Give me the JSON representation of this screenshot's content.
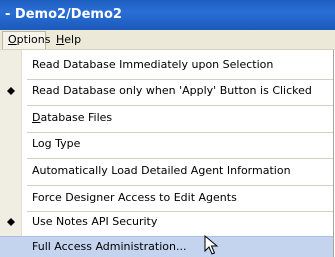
{
  "window": {
    "title": "- Demo2/Demo2"
  },
  "menubar": {
    "options_prefix": "",
    "options_accel": "O",
    "options_rest": "ptions",
    "help_accel": "H",
    "help_rest": "elp"
  },
  "menu_items": [
    {
      "label": "Read Database Immediately upon Selection",
      "checked": false
    },
    {
      "label": "Read Database only when 'Apply' Button is Clicked",
      "checked": true
    },
    {
      "label_accel": "D",
      "label_rest": "atabase Files",
      "checked": false
    },
    {
      "label": "Log Type",
      "checked": false
    },
    {
      "label": "Automatically Load Detailed Agent Information",
      "checked": false
    },
    {
      "label": "Force Designer Access to Edit Agents",
      "checked": false
    },
    {
      "label": "Use Notes API Security",
      "checked": true
    },
    {
      "label": "Full Access Administration...",
      "checked": false,
      "highlighted": true
    }
  ],
  "colors": {
    "title_bar": "#2a6fd6",
    "menu_highlight": "#c5d4ee",
    "check_bullet": "#000000"
  },
  "icons": {
    "check_bullet": "bullet-diamond-icon",
    "cursor": "mouse-pointer-icon"
  }
}
